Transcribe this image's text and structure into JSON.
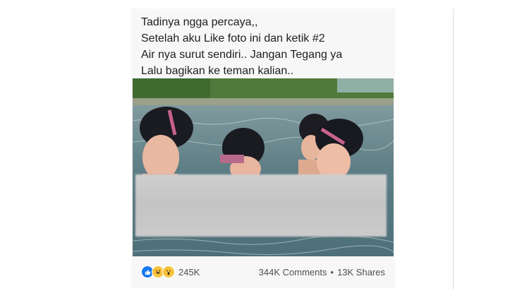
{
  "post": {
    "caption_lines": [
      "Tadinya ngga percaya,,",
      "Setelah aku Like foto ini dan ketik #2",
      "Air nya surut sendiri.. Jangan Tegang ya",
      "Lalu bagikan ke teman kalian.."
    ]
  },
  "footer": {
    "reactions": [
      "like-icon",
      "haha-icon",
      "wow-icon"
    ],
    "reaction_count": "245K",
    "comments": "344K Comments",
    "separator": "•",
    "shares": "13K Shares"
  },
  "colors": {
    "like": "#1877f2",
    "emoji": "#f7c23c",
    "text": "#1c1e21"
  }
}
